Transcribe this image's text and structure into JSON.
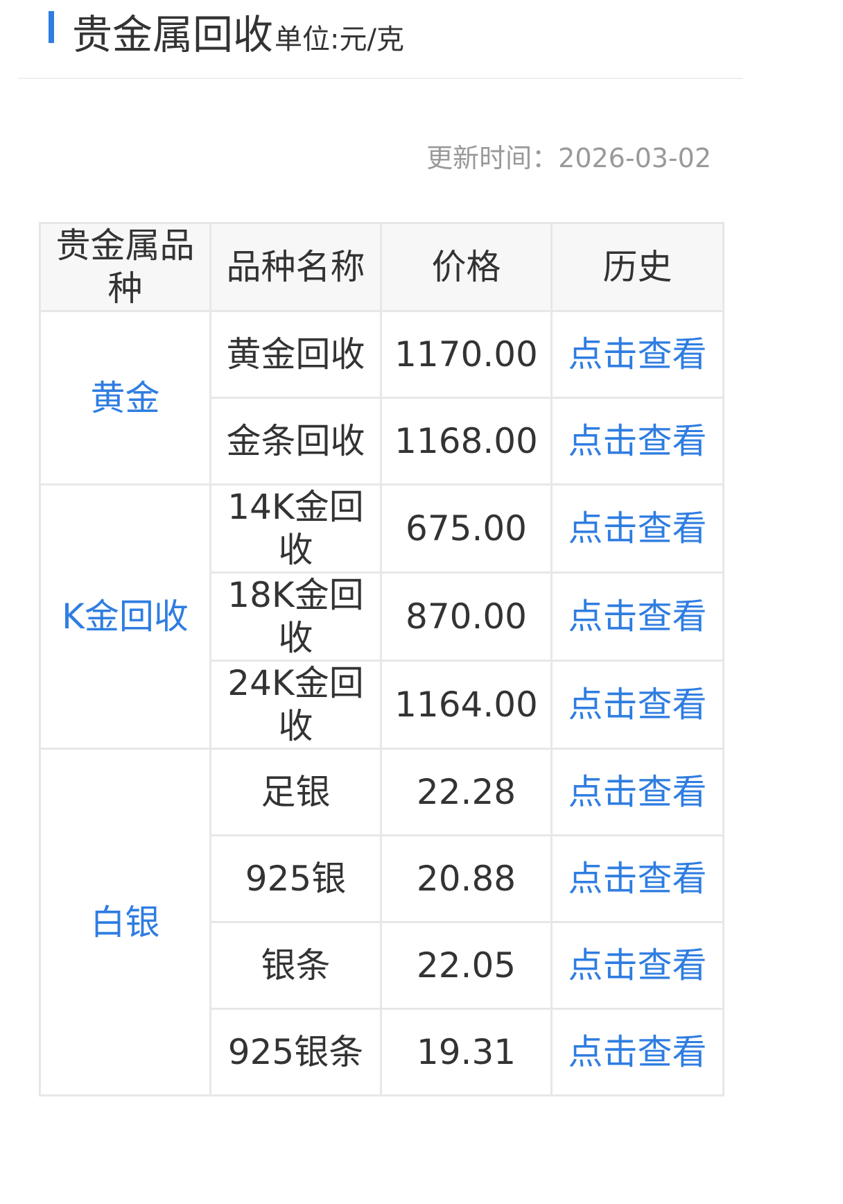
{
  "header": {
    "title": "贵金属回收",
    "unit": "单位:元/克"
  },
  "update": {
    "label": "更新时间：",
    "date": "2026-03-02"
  },
  "table": {
    "columns": [
      "贵金属品种",
      "品种名称",
      "价格",
      "历史"
    ],
    "history_link": "点击查看",
    "groups": [
      {
        "category": "黄金",
        "rows": [
          {
            "name": "黄金回收",
            "price": "1170.00"
          },
          {
            "name": "金条回收",
            "price": "1168.00"
          }
        ]
      },
      {
        "category": "K金回收",
        "rows": [
          {
            "name": "14K金回收",
            "price": "675.00"
          },
          {
            "name": "18K金回收",
            "price": "870.00"
          },
          {
            "name": "24K金回收",
            "price": "1164.00"
          }
        ]
      },
      {
        "category": "白银",
        "rows": [
          {
            "name": "足银",
            "price": "22.28"
          },
          {
            "name": "925银",
            "price": "20.88"
          },
          {
            "name": "银条",
            "price": "22.05"
          },
          {
            "name": "925银条",
            "price": "19.31"
          }
        ]
      }
    ]
  },
  "colors": {
    "accent": "#2f7de1",
    "text": "#333333",
    "muted": "#999999",
    "border": "#e7e7e7",
    "header_bg": "#f7f7f7"
  }
}
